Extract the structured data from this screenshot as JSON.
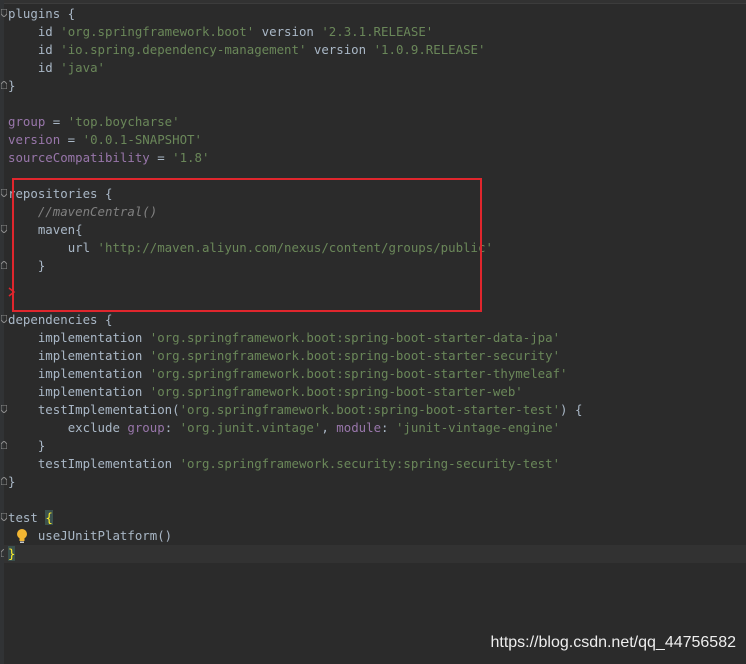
{
  "code": {
    "plugins_open": "plugins {",
    "plugin_1_kw": "id ",
    "plugin_1_str": "'org.springframework.boot'",
    "plugin_1_ver_kw": " version ",
    "plugin_1_ver": "'2.3.1.RELEASE'",
    "plugin_2_kw": "id ",
    "plugin_2_str": "'io.spring.dependency-management'",
    "plugin_2_ver_kw": " version ",
    "plugin_2_ver": "'1.0.9.RELEASE'",
    "plugin_3_kw": "id ",
    "plugin_3_str": "'java'",
    "close_brace": "}",
    "group_name": "group",
    "group_eq": " = ",
    "group_val": "'top.boycharse'",
    "version_name": "version",
    "version_eq": " = ",
    "version_val": "'0.0.1-SNAPSHOT'",
    "source_name": "sourceCompatibility",
    "source_eq": " = ",
    "source_val": "'1.8'",
    "repos_open": "repositories {",
    "maven_central_comment": "//mavenCentral()",
    "maven_open": "maven{",
    "url_kw": "url ",
    "url_val": "'http://maven.aliyun.com/nexus/content/groups/public'",
    "maven_close": "}",
    "deps_open": "dependencies {",
    "impl_kw": "implementation ",
    "dep_1": "'org.springframework.boot:spring-boot-starter-data-jpa'",
    "dep_2": "'org.springframework.boot:spring-boot-starter-security'",
    "dep_3": "'org.springframework.boot:spring-boot-starter-thymeleaf'",
    "dep_4": "'org.springframework.boot:spring-boot-starter-web'",
    "test_impl_open": "testImplementation(",
    "test_dep_1": "'org.springframework.boot:spring-boot-starter-test'",
    "test_impl_close": ") {",
    "exclude_kw": "exclude ",
    "group_param": "group",
    "colon_sp": ": ",
    "exclude_group": "'org.junit.vintage'",
    "comma_sp": ", ",
    "module_param": "module",
    "exclude_module": "'junit-vintage-engine'",
    "inner_close": "}",
    "test_impl_kw": "testImplementation ",
    "test_dep_2": "'org.springframework.security:spring-security-test'",
    "test_open": "test ",
    "test_brace": "{",
    "use_junit": "useJUnitPlatform()",
    "final_brace": "}"
  },
  "watermark": "https://blog.csdn.net/qq_44756582",
  "colors": {
    "background": "#2b2b2b",
    "string": "#6a8759",
    "field": "#9876aa",
    "comment": "#808080",
    "highlight_box": "#e0262d",
    "bulb": "#f2b632"
  },
  "icons": [
    "fold-icon",
    "lightbulb-icon"
  ]
}
